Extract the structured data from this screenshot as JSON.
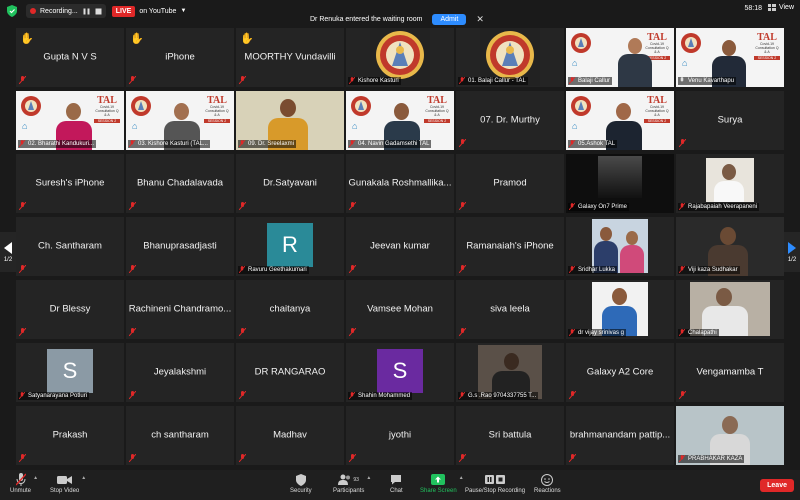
{
  "topbar": {
    "recording_label": "Recording...",
    "live_badge": "LIVE",
    "live_text": "on YouTube",
    "waiting_text": "Dr Renuka entered the waiting room",
    "admit_label": "Admit",
    "timer": "58:18",
    "view_label": "View"
  },
  "tiles": [
    {
      "name": "Gupta N V S",
      "hand": "✋"
    },
    {
      "name": "iPhone",
      "hand": "✋"
    },
    {
      "name": "MOORTHY Vundavilli",
      "hand": "✋"
    },
    {
      "label": "Kishore Kasturi"
    },
    {
      "label": "01. Balaji Callur - TAL"
    },
    {
      "label": "Balaji Callur"
    },
    {
      "label": "Venu Kavarthapu"
    },
    {
      "label": "02. Bharathi Kandukuri..."
    },
    {
      "label": "03. Kishore Kasturi (TAL..."
    },
    {
      "label": "09. Dr. Sreelaxmi"
    },
    {
      "label": "04. Navin Gadamsethi TAL"
    },
    {
      "name": "07. Dr. Murthy"
    },
    {
      "label": "05.Ashok TAL"
    },
    {
      "name": "Surya"
    },
    {
      "name": "Suresh's iPhone"
    },
    {
      "name": "Bhanu Chadalavada"
    },
    {
      "name": "Dr.Satyavani"
    },
    {
      "name": "Gunakala Roshmallika..."
    },
    {
      "name": "Pramod"
    },
    {
      "label": "Galaxy On7 Prime"
    },
    {
      "label": "Rajabapaiah Veerapaneni"
    },
    {
      "name": "Ch. Santharam"
    },
    {
      "name": "Bhanuprasadjasti"
    },
    {
      "label": "Ravuru Geethakumari",
      "letter": "R"
    },
    {
      "name": "Jeevan kumar"
    },
    {
      "name": "Ramanaiah's iPhone"
    },
    {
      "label": "Sridhar Lukka"
    },
    {
      "label": "Viji kaza Sudhakar"
    },
    {
      "name": "Dr Blessy"
    },
    {
      "name": "Rachineni Chandramo..."
    },
    {
      "name": "chaitanya"
    },
    {
      "name": "Vamsee Mohan"
    },
    {
      "name": "siva leela"
    },
    {
      "label": "dr vijay srinivas g"
    },
    {
      "label": "Chalapathi"
    },
    {
      "label": "Satyanarayana Potluri",
      "letter": "S"
    },
    {
      "name": "Jeyalakshmi"
    },
    {
      "name": "DR RANGARAO"
    },
    {
      "label": "Shahin Mohammed",
      "letter": "S"
    },
    {
      "label": "G.s .Rao 9704337755 T..."
    },
    {
      "name": "Galaxy A2 Core"
    },
    {
      "name": "Vengamamba T"
    },
    {
      "name": "Prakash"
    },
    {
      "name": "ch santharam"
    },
    {
      "name": "Madhav"
    },
    {
      "name": "jyothi"
    },
    {
      "name": "Sri battula"
    },
    {
      "name": "brahmanandam pattip..."
    },
    {
      "label": "PRABHAKAR KAZA"
    }
  ],
  "logo": {
    "tal": "TAL",
    "sub": "Covid-19 Consultation Q & A",
    "session": "SESSION 2",
    "telugu_assoc": "TELUGU ASSOCIATION OF LONDON"
  },
  "pager": {
    "left": "1/2",
    "right": "1/2"
  },
  "toolbar": {
    "unmute": "Unmute",
    "stop_video": "Stop Video",
    "security": "Security",
    "participants": "Participants",
    "participant_count": "93",
    "chat": "Chat",
    "share_screen": "Share Screen",
    "pause_recording": "Pause/Stop Recording",
    "reactions": "Reactions",
    "leave": "Leave"
  },
  "colors": {
    "accent": "#2d8cff",
    "live": "#e02828",
    "active_speaker": "#a5e05a",
    "share": "#21c25e",
    "avatar_r": "#2a8a98",
    "avatar_s_grey": "#8b9aa5",
    "avatar_s_purple": "#6a2aa0"
  }
}
